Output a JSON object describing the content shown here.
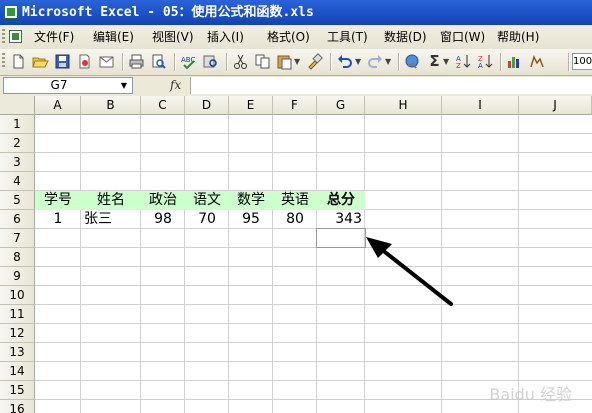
{
  "window": {
    "title": "Microsoft Excel - 05：使用公式和函数.xls"
  },
  "menu": [
    {
      "label": "文件(F)"
    },
    {
      "label": "编辑(E)"
    },
    {
      "label": "视图(V)"
    },
    {
      "label": "插入(I)"
    },
    {
      "label": "格式(O)"
    },
    {
      "label": "工具(T)"
    },
    {
      "label": "数据(D)"
    },
    {
      "label": "窗口(W)"
    },
    {
      "label": "帮助(H)"
    }
  ],
  "toolbar": {
    "zoom": "100"
  },
  "formula_bar": {
    "name_box": "G7",
    "fx": "fx",
    "value": ""
  },
  "columns": [
    "A",
    "B",
    "C",
    "D",
    "E",
    "F",
    "G",
    "H",
    "I",
    "J"
  ],
  "rows": [
    "1",
    "2",
    "3",
    "4",
    "5",
    "6",
    "7",
    "8",
    "9",
    "10",
    "11",
    "12",
    "13",
    "14",
    "15",
    "16"
  ],
  "sheet": {
    "header": {
      "a": "学号",
      "b": "姓名",
      "c": "政治",
      "d": "语文",
      "e": "数学",
      "f": "英语",
      "g": "总分"
    },
    "row6": {
      "a": "1",
      "b": "张三",
      "c": "98",
      "d": "70",
      "e": "95",
      "f": "80",
      "g": "343"
    }
  },
  "highlight_color": "#ccffcc",
  "annotation": {
    "arrow_color": "#000000"
  },
  "watermark": "Baidu 经验"
}
